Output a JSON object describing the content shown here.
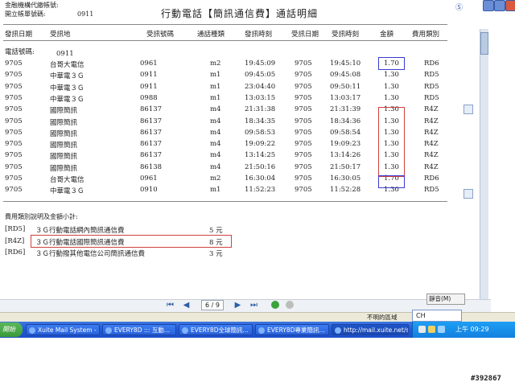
{
  "header": {
    "org_line": "金融機構代繳帳號:",
    "account_label": "開立帳單號碼:",
    "account_value": "0911",
    "title": "行動電話【簡訊通信費】通話明細"
  },
  "columns": [
    "發訊日期",
    "受訊地",
    "受訊號碼",
    "通話種類",
    "發訊時刻",
    "受訊日期",
    "受訊時刻",
    "金額",
    "費用類別"
  ],
  "phone_label": "電話號碼:",
  "phone_value": "0911",
  "rows": [
    {
      "date": "9705",
      "place": "台哥大電信",
      "number": "0961",
      "type": "m2",
      "send_time": "19:45:09",
      "recv_date": "9705",
      "recv_time": "19:45:10",
      "amount": "1.70",
      "code": "RD6"
    },
    {
      "date": "9705",
      "place": "中華電３Ｇ",
      "number": "0911",
      "type": "m1",
      "send_time": "09:45:05",
      "recv_date": "9705",
      "recv_time": "09:45:08",
      "amount": "1.30",
      "code": "RD5"
    },
    {
      "date": "9705",
      "place": "中華電３Ｇ",
      "number": "0911",
      "type": "m1",
      "send_time": "23:04:40",
      "recv_date": "9705",
      "recv_time": "09:50:11",
      "amount": "1.30",
      "code": "RD5"
    },
    {
      "date": "9705",
      "place": "中華電３Ｇ",
      "number": "0988",
      "type": "m1",
      "send_time": "13:03:15",
      "recv_date": "9705",
      "recv_time": "13:03:17",
      "amount": "1.30",
      "code": "RD5"
    },
    {
      "date": "9705",
      "place": "國際簡訊",
      "number": "86137",
      "type": "m4",
      "send_time": "21:31:38",
      "recv_date": "9705",
      "recv_time": "21:31:39",
      "amount": "1.30",
      "code": "R4Z"
    },
    {
      "date": "9705",
      "place": "國際簡訊",
      "number": "86137",
      "type": "m4",
      "send_time": "18:34:35",
      "recv_date": "9705",
      "recv_time": "18:34:36",
      "amount": "1.30",
      "code": "R4Z"
    },
    {
      "date": "9705",
      "place": "國際簡訊",
      "number": "86137",
      "type": "m4",
      "send_time": "09:58:53",
      "recv_date": "9705",
      "recv_time": "09:58:54",
      "amount": "1.30",
      "code": "R4Z"
    },
    {
      "date": "9705",
      "place": "國際簡訊",
      "number": "86137",
      "type": "m4",
      "send_time": "19:09:22",
      "recv_date": "9705",
      "recv_time": "19:09:23",
      "amount": "1.30",
      "code": "R4Z"
    },
    {
      "date": "9705",
      "place": "國際簡訊",
      "number": "86137",
      "type": "m4",
      "send_time": "13:14:25",
      "recv_date": "9705",
      "recv_time": "13:14:26",
      "amount": "1.30",
      "code": "R4Z"
    },
    {
      "date": "9705",
      "place": "國際簡訊",
      "number": "86138",
      "type": "m4",
      "send_time": "21:50:16",
      "recv_date": "9705",
      "recv_time": "21:50:17",
      "amount": "1.30",
      "code": "R4Z"
    },
    {
      "date": "9705",
      "place": "台哥大電信",
      "number": "0961",
      "type": "m2",
      "send_time": "16:30:04",
      "recv_date": "9705",
      "recv_time": "16:30:05",
      "amount": "1.70",
      "code": "RD6"
    },
    {
      "date": "9705",
      "place": "中華電３Ｇ",
      "number": "0910",
      "type": "m1",
      "send_time": "11:52:23",
      "recv_date": "9705",
      "recv_time": "11:52:28",
      "amount": "1.30",
      "code": "RD5"
    }
  ],
  "fee_title": "費用類別說明及金額小計:",
  "fees": [
    {
      "code": "[RD5]",
      "desc": "３Ｇ行動電話網內簡訊通信費",
      "amount": "5 元"
    },
    {
      "code": "[R4Z]",
      "desc": "３Ｇ行動電話國際簡訊通信費",
      "amount": "8 元"
    },
    {
      "code": "[RD6]",
      "desc": "３Ｇ行動撥其他電信公司簡訊通信費",
      "amount": "3 元"
    }
  ],
  "pdf_toolbar": {
    "page": "6 / 9"
  },
  "mute_label": "靜音(M)",
  "status_text": "不明的區域",
  "ime_text": "CH",
  "clock": "上午 09:29",
  "taskbar": {
    "start": "開始",
    "tasks": [
      "Xuite Mail System - ...",
      "EVERY8D ::: 互動...",
      "EVERY8D全球簡訊...",
      "EVERY8D專業簡訊...",
      "http://mail.xuite.net/st..."
    ]
  },
  "watermark": "#392867"
}
